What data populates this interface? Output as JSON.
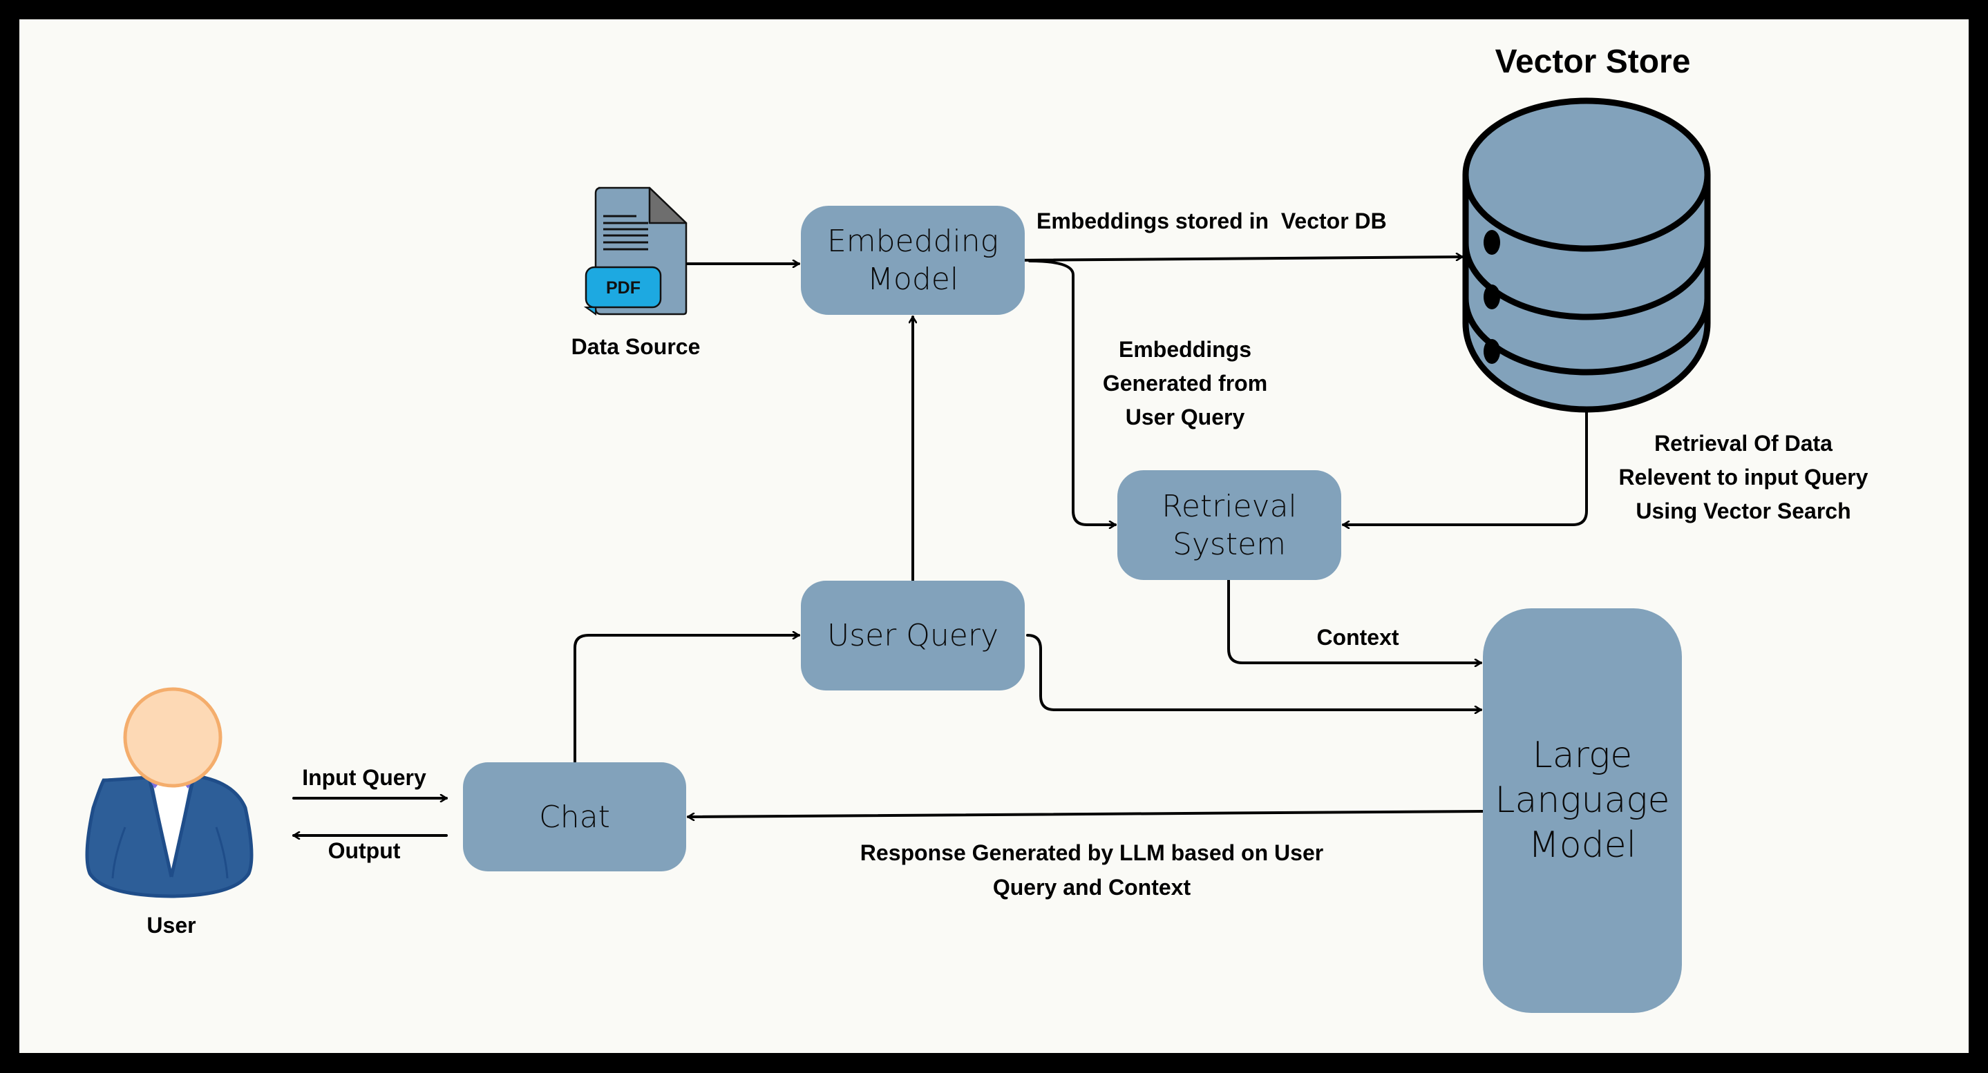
{
  "diagram": {
    "title": "Vector Store",
    "nodes": {
      "data_source": {
        "label": "Data Source",
        "icon": "pdf-file-icon",
        "icon_text": "PDF"
      },
      "embedding_model": {
        "line1": "Embedding",
        "line2": "Model"
      },
      "vector_store": {
        "label": "Vector Store",
        "icon": "database-icon"
      },
      "retrieval_system": {
        "line1": "Retrieval",
        "line2": "System"
      },
      "user_query": {
        "label": "User Query"
      },
      "chat": {
        "label": "Chat"
      },
      "llm": {
        "line1": "Large",
        "line2": "Language",
        "line3": "Model"
      },
      "user": {
        "label": "User",
        "icon": "user-avatar-icon"
      }
    },
    "edge_labels": {
      "embeddings_stored": "Embeddings stored in  Vector DB",
      "embeddings_generated": [
        "Embeddings",
        "Generated from",
        "User Query"
      ],
      "retrieval_of_data": [
        "Retrieval Of Data",
        "Relevent to input Query",
        "Using Vector Search"
      ],
      "context": "Context",
      "input_query": "Input Query",
      "output": "Output",
      "response": [
        "Response Generated by LLM based on User",
        "Query and Context"
      ]
    },
    "colors": {
      "box_fill": "#82a2bb",
      "background": "#fafaf6",
      "frame": "#000000",
      "pdf_badge": "#1da9e1",
      "user_suit": "#2d5e98",
      "user_face": "#fdd9b5",
      "user_face_outline": "#f4ad6c"
    }
  }
}
